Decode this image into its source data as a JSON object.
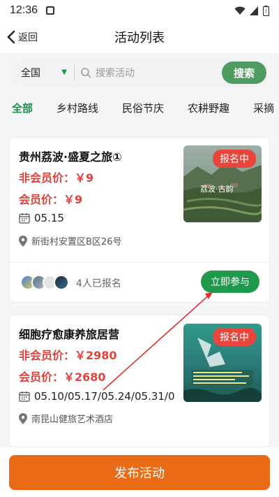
{
  "status_bar": {
    "time": "12:36"
  },
  "nav": {
    "back_label": "返回",
    "title": "活动列表"
  },
  "search": {
    "region": "全国",
    "placeholder": "搜索活动",
    "button_label": "搜索"
  },
  "tabs": [
    "全部",
    "乡村路线",
    "民俗节庆",
    "农耕野趣",
    "采摘"
  ],
  "activities": [
    {
      "title": "贵州荔波·盛夏之旅①",
      "non_member_price": "非会员价：￥9",
      "member_price": "会员价：￥9",
      "dates": "05.15",
      "location": "新街村安置区B区26号",
      "tag": "报名中",
      "image_caption": "荔波·古韵",
      "enrolled": "4人已报名",
      "join_label": "立即参与"
    },
    {
      "title": "细胞疗愈康养旅居营",
      "non_member_price": "非会员价：￥2980",
      "member_price": "会员价：￥2680",
      "dates": "05.10/05.17/05.24/05.31/0",
      "location": "南昆山健旅艺术酒店",
      "tag": "报名中"
    }
  ],
  "footer": {
    "publish_label": "发布活动"
  },
  "colors": {
    "primary_green": "#1f9a4c",
    "price_red": "#e0413a",
    "publish_orange": "#ea6b16",
    "tag_red": "#e8453c"
  }
}
